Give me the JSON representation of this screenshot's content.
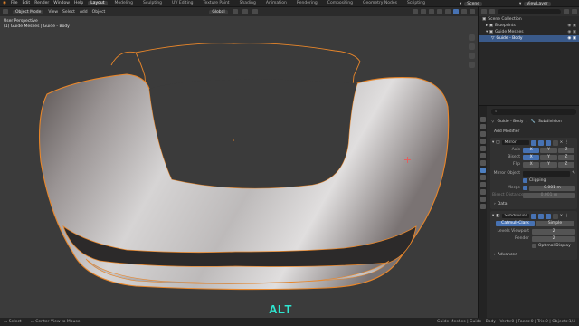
{
  "topbar": {
    "menus": [
      "File",
      "Edit",
      "Render",
      "Window",
      "Help"
    ],
    "tabs": [
      "Layout",
      "Modeling",
      "Sculpting",
      "UV Editing",
      "Texture Paint",
      "Shading",
      "Animation",
      "Rendering",
      "Compositing",
      "Geometry Nodes",
      "Scripting"
    ],
    "active_tab": "Layout",
    "scene_label": "Scene",
    "view_layer_label": "ViewLayer"
  },
  "header": {
    "mode": "Object Mode",
    "menus": [
      "View",
      "Select",
      "Add",
      "Object"
    ],
    "transform_orientation": "Global"
  },
  "viewport": {
    "view_name": "User Perspective",
    "object_info": "(1) Guide Meshes | Guide - Body",
    "overlay_text": "ALT"
  },
  "outliner": {
    "search_placeholder": "",
    "rows": [
      {
        "label": "Scene Collection",
        "indent": 0
      },
      {
        "label": "Blueprints",
        "indent": 1
      },
      {
        "label": "Guide Meshes",
        "indent": 1
      },
      {
        "label": "Guide - Body",
        "indent": 2,
        "selected": true
      }
    ]
  },
  "properties": {
    "breadcrumb_object": "Guide - Body",
    "breadcrumb_modifier": "Subdivision",
    "add_modifier_label": "Add Modifier",
    "mirror": {
      "name": "Mirror",
      "axis_label": "Axis",
      "bisect_label": "Bisect",
      "flip_label": "Flip",
      "axes": [
        "X",
        "Y",
        "Z"
      ],
      "mirror_object_label": "Mirror Object",
      "clipping_label": "Clipping",
      "merge_label": "Merge",
      "merge_value": "0.001 m",
      "bisect_distance_label": "Bisect Distance",
      "bisect_distance_value": "0.001 m",
      "data_label": "Data"
    },
    "subdivision": {
      "name": "Subdivision",
      "catmull_label": "Catmull-Clark",
      "simple_label": "Simple",
      "levels_viewport_label": "Levels Viewport",
      "levels_viewport_value": "2",
      "render_label": "Render",
      "render_value": "2",
      "optimal_display_label": "Optimal Display",
      "advanced_label": "Advanced"
    }
  },
  "statusbar": {
    "select": "Select",
    "center": "Center View to Mouse",
    "right": "Guide Meshes | Guide - Body | Verts:0 | Faces:0 | Tris:0 | Objects:1/4"
  },
  "colors": {
    "accent": "#4772b3",
    "overlay_text": "#2ee6d0",
    "selection_outline": "#e8862a"
  }
}
